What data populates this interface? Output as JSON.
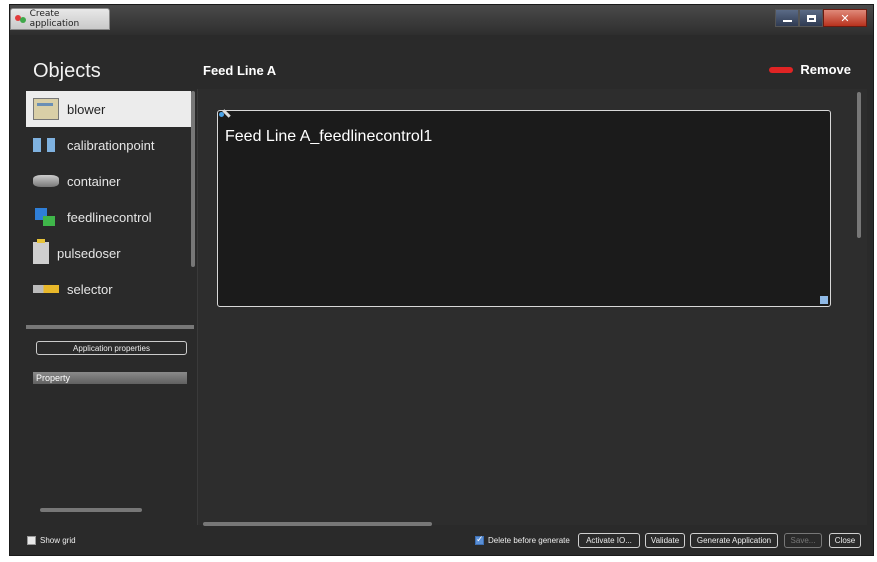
{
  "window": {
    "title": "Create application"
  },
  "sidebar": {
    "heading": "Objects",
    "items": [
      {
        "label": "blower",
        "icon": "blower-icon",
        "selected": true
      },
      {
        "label": "calibrationpoint",
        "icon": "calibrationpoint-icon"
      },
      {
        "label": "container",
        "icon": "container-icon"
      },
      {
        "label": "feedlinecontrol",
        "icon": "feedlinecontrol-icon"
      },
      {
        "label": "pulsedoser",
        "icon": "pulsedoser-icon"
      },
      {
        "label": "selector",
        "icon": "selector-icon"
      }
    ],
    "app_props_label": "Application properties",
    "property_header": "Property"
  },
  "main": {
    "title": "Feed Line A",
    "remove_label": "Remove",
    "node_label": "Feed Line A_feedlinecontrol1"
  },
  "footer": {
    "show_grid_label": "Show grid",
    "show_grid_checked": false,
    "delete_before_generate_label": "Delete before generate",
    "delete_before_generate_checked": true,
    "activate_io_label": "Activate IO...",
    "validate_label": "Validate",
    "generate_label": "Generate Application",
    "save_label": "Save...",
    "close_label": "Close"
  },
  "colors": {
    "background": "#2a2a2a",
    "remove_accent": "#e02424",
    "selected_item": "#ececec"
  }
}
